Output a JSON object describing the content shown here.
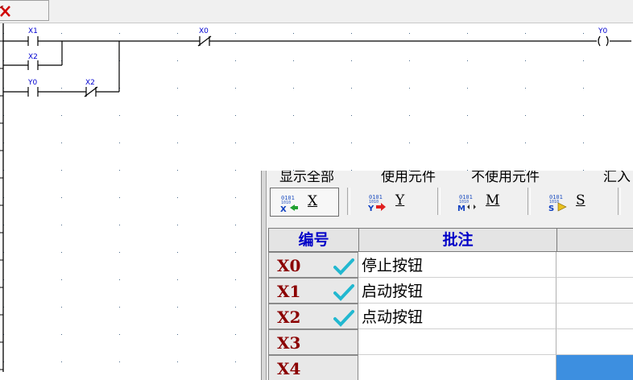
{
  "toolbar": {
    "close_icon": "red-x-icon"
  },
  "ladder": {
    "contacts": [
      "X1",
      "X2",
      "Y0",
      "X2",
      "X0"
    ],
    "coil": "Y0"
  },
  "panel": {
    "menu": [
      "显示全部",
      "使用元件",
      "不使用元件",
      "汇入"
    ],
    "filters": [
      {
        "label": "X",
        "icon": "x-input-icon"
      },
      {
        "label": "Y",
        "icon": "y-output-icon"
      },
      {
        "label": "M",
        "icon": "m-relay-icon"
      },
      {
        "label": "S",
        "icon": "s-state-icon"
      }
    ],
    "headers": {
      "id": "编号",
      "comment": "批注"
    },
    "rows": [
      {
        "id": "X0",
        "checked": true,
        "comment": "停止按钮"
      },
      {
        "id": "X1",
        "checked": true,
        "comment": "启动按钮"
      },
      {
        "id": "X2",
        "checked": true,
        "comment": "点动按钮"
      },
      {
        "id": "X3",
        "checked": false,
        "comment": ""
      },
      {
        "id": "X4",
        "checked": false,
        "comment": ""
      }
    ],
    "colors": {
      "id_text": "#8b0000",
      "header_text": "#0000c8",
      "check": "#22b8d0",
      "selection": "#3d8fe0"
    }
  }
}
